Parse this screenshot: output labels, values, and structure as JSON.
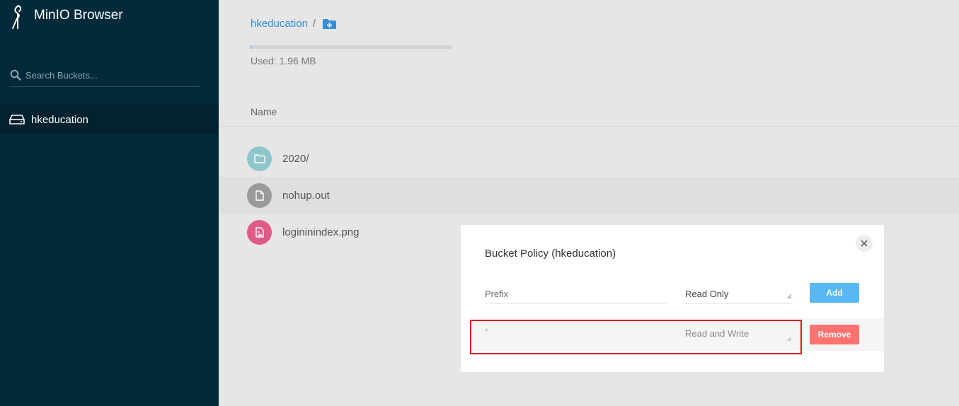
{
  "app": {
    "title": "MinIO Browser"
  },
  "sidebar": {
    "search": {
      "placeholder": "Search Buckets..."
    },
    "buckets": [
      {
        "name": "hkeducation",
        "icon": "drive-icon",
        "active": true
      }
    ]
  },
  "main": {
    "breadcrumb": {
      "bucket": "hkeducation",
      "separator": "/",
      "add_icon": "add-folder-icon"
    },
    "usage": {
      "text": "Used: 1.96 MB",
      "fraction": 0.003
    },
    "table": {
      "header": "Name",
      "rows": [
        {
          "name": "2020/",
          "icon": "folder-icon",
          "color": "#8fc6cc"
        },
        {
          "name": "nohup.out",
          "icon": "file-icon",
          "color": "#9a9a9a"
        },
        {
          "name": "logininindex.png",
          "icon": "image-file-icon",
          "color": "#df5b85"
        }
      ]
    }
  },
  "modal": {
    "title": "Bucket Policy (hkeducation)",
    "close_icon": "close-icon",
    "new_policy": {
      "prefix_placeholder": "Prefix",
      "selected": "Read Only",
      "add_label": "Add"
    },
    "policies": [
      {
        "prefix": "*",
        "policy": "Read and Write",
        "remove_label": "Remove"
      }
    ]
  },
  "colors": {
    "sidebar": "#032a3b",
    "accent": "#2f8fd8",
    "add": "#59b7f4",
    "remove": "#ff726f",
    "highlight": "#d91e1e"
  }
}
